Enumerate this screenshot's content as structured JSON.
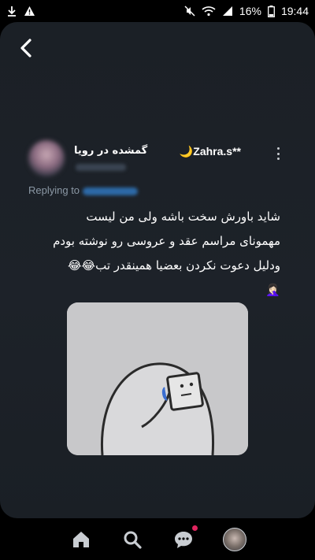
{
  "status_bar": {
    "battery_percent": "16%",
    "time": "19:44",
    "icons": [
      "download-icon",
      "warning-icon",
      "mute-icon",
      "wifi-icon",
      "signal-icon",
      "battery-icon"
    ]
  },
  "tweet": {
    "author_name": "Zahra.s**",
    "display_name": "گمشده در رویا",
    "replying_prefix": "Replying to",
    "text_lines": [
      "شاید باورش سخت باشه ولی من لیست",
      "مهمونای مراسم عقد و عروسی رو نوشته بودم",
      "ودلیل دعوت نکردن بعضیا همینقدر تب😂😂",
      "🤦🏻‍♀️"
    ]
  },
  "bottom_nav": {
    "items": [
      "home-icon",
      "search-icon",
      "messages-icon",
      "profile-avatar"
    ]
  },
  "colors": {
    "card_background": "#1c2127",
    "link": "#1d9bf0",
    "muted": "#8b98a5",
    "notification": "#e0245e"
  }
}
